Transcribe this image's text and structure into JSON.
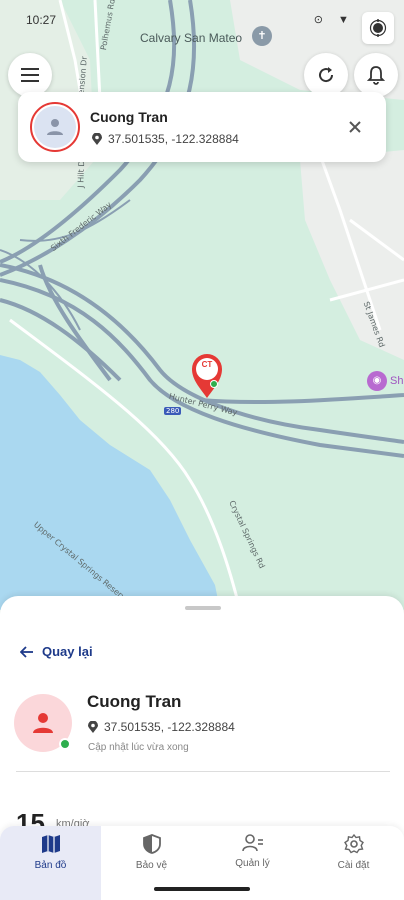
{
  "status_bar": {
    "time": "10:27"
  },
  "map": {
    "place_name": "Calvary San Mateo",
    "shop_label": "Sh",
    "marker_initials": "CT",
    "road_labels": [
      "Polhemus Rd",
      "Ascension Dr",
      "J Hilt Dr",
      "Sixth Frederic Way",
      "Sixth Frederic Way",
      "Sixth Frederic Way",
      "St James Rd",
      "Crystal Springs Rd",
      "Upper Crystal Springs Reservoir",
      "Hunter Perry Way"
    ],
    "highway_shield": "280"
  },
  "info_card": {
    "name": "Cuong Tran",
    "coords": "37.501535, -122.328884"
  },
  "sheet": {
    "back_label": "Quay lại",
    "name": "Cuong Tran",
    "coords": "37.501535, -122.328884",
    "updated": "Cập nhật lúc vừa xong",
    "count": "15",
    "count_sub": "km/giờ"
  },
  "nav": {
    "items": [
      {
        "label": "Bản đồ"
      },
      {
        "label": "Bảo vệ"
      },
      {
        "label": "Quản lý"
      },
      {
        "label": "Cài đặt"
      }
    ]
  },
  "colors": {
    "accent": "#1e3a8a",
    "marker": "#e53935",
    "online": "#2eae4e",
    "water": "#aad8f0",
    "map_bg": "#d4eee0"
  }
}
